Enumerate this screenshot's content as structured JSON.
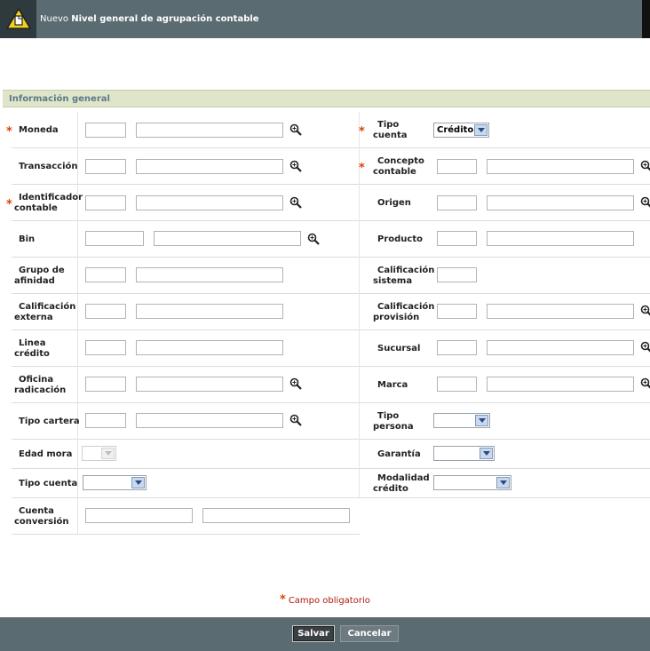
{
  "header": {
    "title_prefix": "Nuevo",
    "title_main": "Nivel general de agrupación contable",
    "icon": "warning-document-icon"
  },
  "section": {
    "title": "Información general"
  },
  "fields": {
    "moneda": "Moneda",
    "tipo_cuenta_1": "Tipo",
    "tipo_cuenta_2": "cuenta",
    "tipo_cuenta_value": "Crédito",
    "transaccion": "Transacción",
    "concepto_1": "Concepto",
    "concepto_2": "contable",
    "identificador_1": "Identificador",
    "identificador_2": "contable",
    "origen": "Origen",
    "bin": "Bin",
    "producto": "Producto",
    "grupo_1": "Grupo de",
    "grupo_2": "afinidad",
    "calif_sistema_1": "Calificación",
    "calif_sistema_2": "sistema",
    "calif_externa_1": "Calificación",
    "calif_externa_2": "externa",
    "calif_provision_1": "Calificación",
    "calif_provision_2": "provisión",
    "linea_1": "Linea",
    "linea_2": "crédito",
    "sucursal": "Sucursal",
    "oficina_1": "Oficina",
    "oficina_2": "radicación",
    "marca": "Marca",
    "tipo_cartera": "Tipo cartera",
    "tipo_persona_1": "Tipo",
    "tipo_persona_2": "persona",
    "edad_mora": "Edad mora",
    "garantia": "Garantía",
    "tipo_cuenta_b": "Tipo cuenta",
    "modalidad_1": "Modalidad",
    "modalidad_2": "crédito",
    "cuenta_conv_1": "Cuenta",
    "cuenta_conv_2": "conversión"
  },
  "required_marker": "*",
  "footer_note": "Campo obligatorio",
  "buttons": {
    "save": "Salvar",
    "cancel": "Cancelar"
  },
  "colors": {
    "header": "#5b6b72",
    "section_bg": "#dfe5c8",
    "required": "#d9420b"
  }
}
